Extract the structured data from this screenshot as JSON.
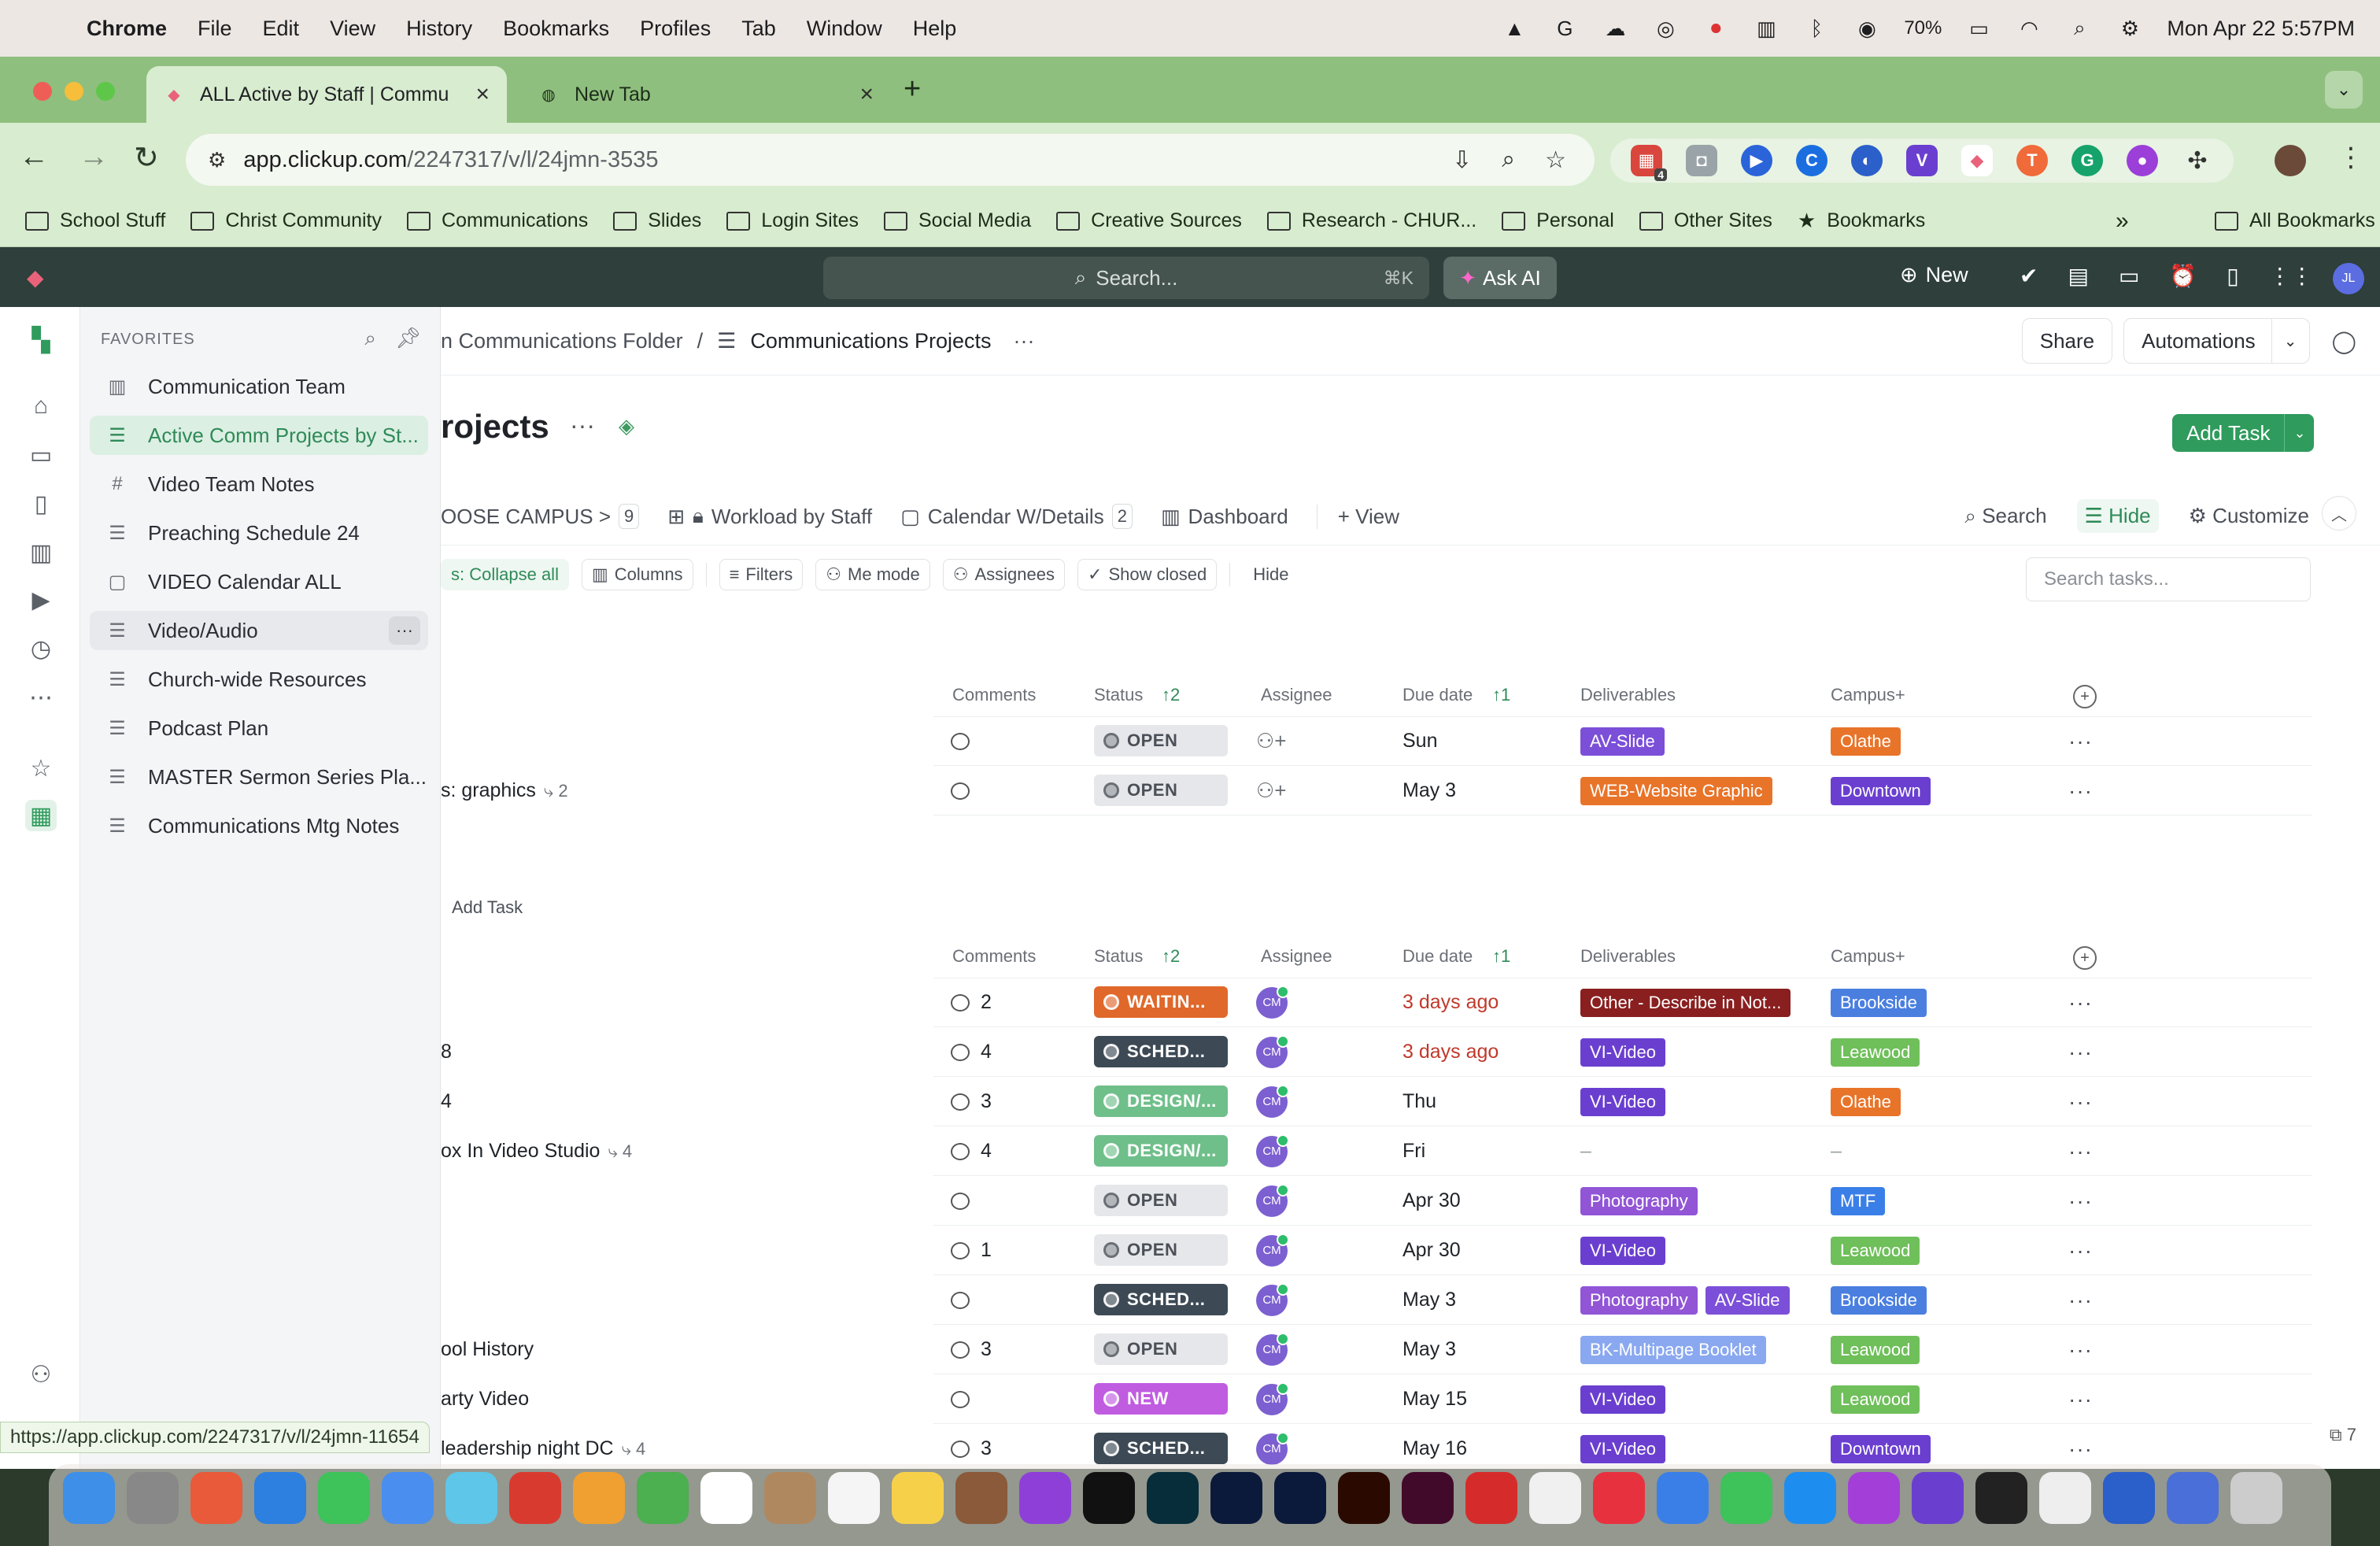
{
  "menubar": {
    "app_name": "Chrome",
    "items": [
      "File",
      "Edit",
      "View",
      "History",
      "Bookmarks",
      "Profiles",
      "Tab",
      "Window",
      "Help"
    ],
    "battery": "70%",
    "datetime": "Mon Apr 22  5:57PM"
  },
  "tabs": [
    {
      "title": "ALL Active by Staff | Commu",
      "active": true
    },
    {
      "title": "New Tab",
      "active": false
    }
  ],
  "url": {
    "host": "app.clickup.com",
    "path": "/2247317/v/l/24jmn-3535"
  },
  "extensions": {
    "badge": "4"
  },
  "bookmarks": [
    "School Stuff",
    "Christ Community",
    "Communications",
    "Slides",
    "Login Sites",
    "Social Media",
    "Creative Sources",
    "Research - CHUR...",
    "Personal",
    "Other Sites"
  ],
  "bookmarks_star": "Bookmarks",
  "bookmarks_more": "»",
  "bookmarks_all": "All Bookmarks",
  "clickup_top": {
    "search": "Search...",
    "search_kbd": "⌘K",
    "ask_ai": "Ask AI",
    "new_label": "New",
    "user_initials": "JL"
  },
  "favorites": {
    "header": "FAVORITES",
    "items": [
      {
        "label": "Communication Team",
        "icon": "chart"
      },
      {
        "label": "Active Comm Projects by St...",
        "icon": "list",
        "active": true
      },
      {
        "label": "Video Team Notes",
        "icon": "hash"
      },
      {
        "label": "Preaching Schedule 24",
        "icon": "list"
      },
      {
        "label": "VIDEO Calendar ALL",
        "icon": "calendar"
      },
      {
        "label": "Video/Audio",
        "icon": "list",
        "hover": true
      },
      {
        "label": "Church-wide Resources",
        "icon": "list"
      },
      {
        "label": "Podcast Plan",
        "icon": "list"
      },
      {
        "label": "MASTER Sermon Series Pla...",
        "icon": "list"
      },
      {
        "label": "Communications Mtg Notes",
        "icon": "list"
      }
    ]
  },
  "breadcrumb": {
    "folder": "n Communications Folder",
    "separator": "/",
    "current": "Communications Projects",
    "more": "···"
  },
  "header_buttons": {
    "share": "Share",
    "automations": "Automations"
  },
  "page": {
    "title": "rojects",
    "more": "···",
    "add_task": "Add Task"
  },
  "views": {
    "campus": "OOSE CAMPUS >",
    "campus_count": "9",
    "workload": "Workload by Staff",
    "calendar": "Calendar W/Details",
    "calendar_count": "2",
    "dashboard": "Dashboard",
    "add_view": "+ View",
    "search": "Search",
    "hide": "Hide",
    "customize": "Customize"
  },
  "filters": {
    "collapse": "s: Collapse all",
    "columns": "Columns",
    "filters": "Filters",
    "me_mode": "Me mode",
    "assignees": "Assignees",
    "show_closed": "Show closed",
    "hide": "Hide",
    "search_placeholder": "Search tasks..."
  },
  "columns": {
    "comments": "Comments",
    "status": "Status",
    "status_sort": "↑2",
    "assignee": "Assignee",
    "due": "Due date",
    "due_sort": "↑1",
    "deliverables": "Deliverables",
    "campus": "Campus+"
  },
  "add_task_inline": "Add Task",
  "group1_rows": [
    {
      "name": "",
      "comments": "",
      "status": "OPEN",
      "due": "Sun",
      "deliverables": [
        "AV-Slide"
      ],
      "campus": "Olathe"
    },
    {
      "name": "s: graphics",
      "subtasks": "2",
      "comments": "",
      "status": "OPEN",
      "due": "May 3",
      "deliverables": [
        "WEB-Website Graphic"
      ],
      "campus": "Downtown"
    }
  ],
  "group2_rows": [
    {
      "name": "",
      "comments": "2",
      "status": "WAITIN...",
      "due": "3 days ago",
      "deliverables": [
        "Other - Describe in Not..."
      ],
      "campus": "Brookside"
    },
    {
      "name": "8",
      "comments": "4",
      "status": "SCHED...",
      "due": "3 days ago",
      "deliverables": [
        "VI-Video"
      ],
      "campus": "Leawood"
    },
    {
      "name": "4",
      "comments": "3",
      "status": "DESIGN/...",
      "due": "Thu",
      "deliverables": [
        "VI-Video"
      ],
      "campus": "Olathe"
    },
    {
      "name": "ox In Video Studio",
      "subtasks": "4",
      "comments": "4",
      "status": "DESIGN/...",
      "due": "Fri",
      "deliverables": [],
      "campus": "–"
    },
    {
      "name": "",
      "comments": "",
      "status": "OPEN",
      "due": "Apr 30",
      "deliverables": [
        "Photography"
      ],
      "campus": "MTF"
    },
    {
      "name": "",
      "comments": "1",
      "status": "OPEN",
      "due": "Apr 30",
      "deliverables": [
        "VI-Video"
      ],
      "campus": "Leawood"
    },
    {
      "name": "",
      "comments": "",
      "status": "SCHED...",
      "due": "May 3",
      "deliverables": [
        "Photography",
        "AV-Slide"
      ],
      "campus": "Brookside"
    },
    {
      "name": "ool History",
      "comments": "3",
      "status": "OPEN",
      "due": "May 3",
      "deliverables": [
        "BK-Multipage Booklet"
      ],
      "campus": "Leawood"
    },
    {
      "name": "arty Video",
      "comments": "",
      "status": "NEW",
      "due": "May 15",
      "deliverables": [
        "VI-Video"
      ],
      "campus": "Leawood"
    },
    {
      "name": "leadership night DC",
      "subtasks": "4",
      "comments": "3",
      "status": "SCHED...",
      "due": "May 16",
      "deliverables": [
        "VI-Video"
      ],
      "campus": "Downtown"
    }
  ],
  "assignee_initials": "CM",
  "status_bar_url": "https://app.clickup.com/2247317/v/l/24jmn-11654",
  "corner_count": "7",
  "colors": {
    "accent_green": "#2f9b5c",
    "status_waiting": "#e0682b",
    "status_scheduled": "#3d4a55",
    "status_design": "#6fbf8a",
    "status_new": "#c05ce0",
    "tag_av_slide": "#7b4fd8",
    "tag_web": "#e8742a",
    "tag_video": "#6a3fd0",
    "tag_photo": "#9155d6",
    "tag_other": "#8a1f1f",
    "tag_booklet": "#8aa8f0",
    "campus_olathe": "#e8742a",
    "campus_downtown": "#6a3fd0",
    "campus_brookside": "#4a7fe0",
    "campus_leawood": "#6fbf5a",
    "campus_mtf": "#3a7fe8"
  }
}
